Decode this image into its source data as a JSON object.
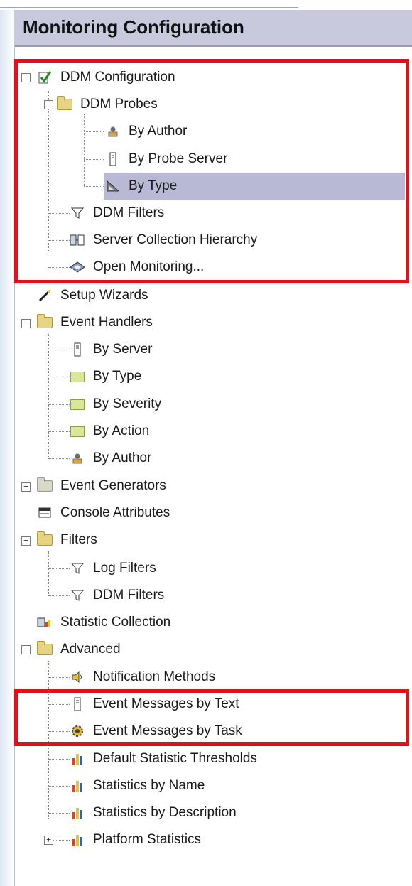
{
  "panel": {
    "title": "Monitoring Configuration"
  },
  "tree": {
    "ddm_configuration": "DDM Configuration",
    "ddm_probes": "DDM Probes",
    "by_author": "By Author",
    "by_probe_server": "By Probe Server",
    "by_type": "By Type",
    "ddm_filters": "DDM Filters",
    "server_collection_hierarchy": "Server Collection Hierarchy",
    "open_monitoring": "Open Monitoring...",
    "setup_wizards": "Setup Wizards",
    "event_handlers": "Event Handlers",
    "eh_by_server": "By Server",
    "eh_by_type": "By Type",
    "eh_by_severity": "By Severity",
    "eh_by_action": "By Action",
    "eh_by_author": "By Author",
    "event_generators": "Event Generators",
    "console_attributes": "Console Attributes",
    "filters": "Filters",
    "log_filters": "Log Filters",
    "filters_ddm_filters": "DDM Filters",
    "statistic_collection": "Statistic Collection",
    "advanced": "Advanced",
    "notification_methods": "Notification Methods",
    "event_messages_by_text": "Event Messages by Text",
    "event_messages_by_task": "Event Messages by Task",
    "default_statistic_thresholds": "Default Statistic Thresholds",
    "statistics_by_name": "Statistics by Name",
    "statistics_by_description": "Statistics by Description",
    "platform_statistics": "Platform Statistics"
  },
  "colors": {
    "highlight_box": "#e3101a",
    "selection": "#b9b9d6",
    "header": "#c9c9dd"
  }
}
